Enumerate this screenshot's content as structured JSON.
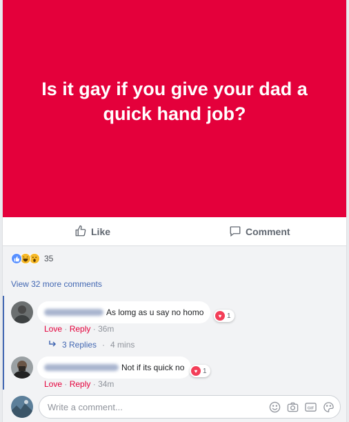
{
  "post": {
    "text": "Is it gay if you give your dad a quick hand job?",
    "background_color": "#e4003b"
  },
  "actions": {
    "like_label": "Like",
    "comment_label": "Comment"
  },
  "reactions": {
    "count": "35",
    "types": [
      "like-icon",
      "haha-icon",
      "wow-icon"
    ]
  },
  "view_more": "View 32 more comments",
  "comments": [
    {
      "text": "As lomg as u say no homo",
      "reaction_count": "1",
      "love_label": "Love",
      "reply_label": "Reply",
      "time": "36m"
    },
    {
      "text": "Not if its quick no",
      "reaction_count": "1",
      "love_label": "Love",
      "reply_label": "Reply",
      "time": "34m"
    }
  ],
  "replies": {
    "label": "3 Replies",
    "time": "4 mins"
  },
  "composer": {
    "placeholder": "Write a comment...",
    "tools": [
      "emoji-icon",
      "camera-icon",
      "gif-icon",
      "sticker-icon"
    ]
  },
  "colors": {
    "accent": "#4267b2",
    "love": "#f33e58",
    "love_link": "#e4003b"
  }
}
